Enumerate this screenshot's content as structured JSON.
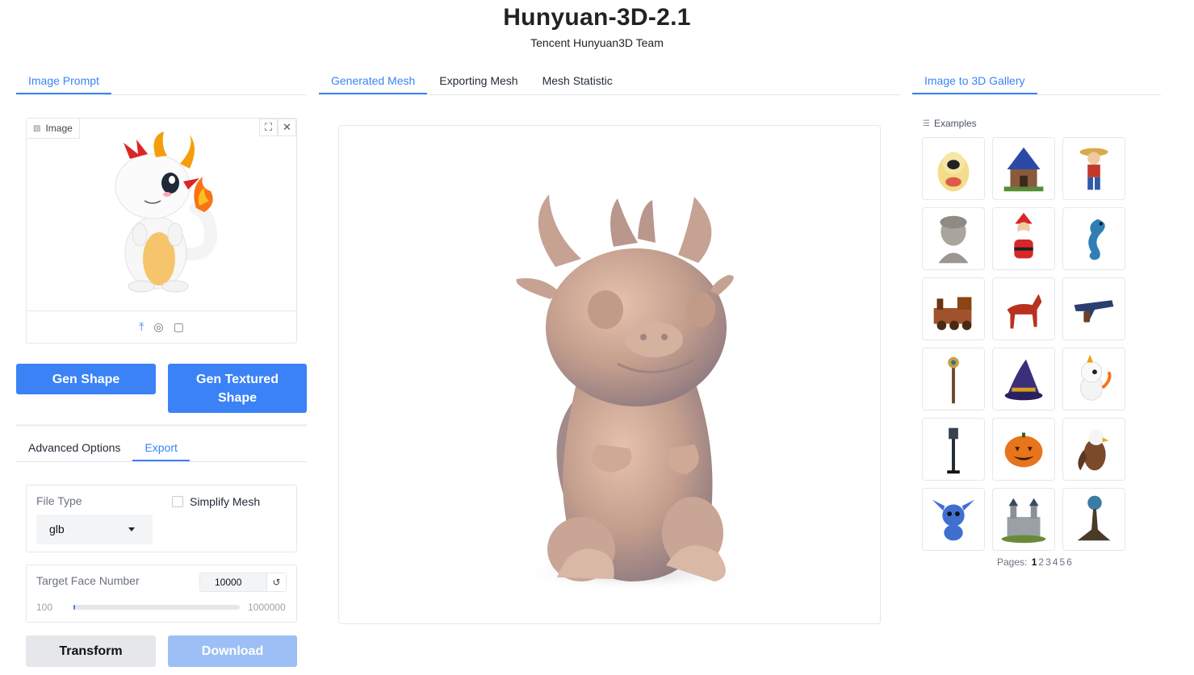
{
  "header": {
    "title": "Hunyuan-3D-2.1",
    "subtitle": "Tencent Hunyuan3D Team"
  },
  "left_tabs": [
    {
      "label": "Image Prompt",
      "active": true
    }
  ],
  "middle_tabs": [
    {
      "label": "Generated Mesh",
      "active": true
    },
    {
      "label": "Exporting Mesh",
      "active": false
    },
    {
      "label": "Mesh Statistic",
      "active": false
    }
  ],
  "right_tabs": [
    {
      "label": "Image to 3D Gallery",
      "active": true
    }
  ],
  "image_input": {
    "label": "Image"
  },
  "buttons": {
    "gen_shape": "Gen Shape",
    "gen_textured_l1": "Gen Textured",
    "gen_textured_l2": "Shape",
    "transform": "Transform",
    "download": "Download"
  },
  "options_tabs": [
    {
      "label": "Advanced Options",
      "active": false
    },
    {
      "label": "Export",
      "active": true
    }
  ],
  "export": {
    "file_type_label": "File Type",
    "file_type_value": "glb",
    "simplify_label": "Simplify Mesh",
    "simplify_checked": false,
    "target_face_label": "Target Face Number",
    "target_face_value": "10000",
    "slider_min": "100",
    "slider_max": "1000000",
    "slider_fraction": 0.01
  },
  "gallery": {
    "label": "Examples",
    "items": [
      "penguin-doll",
      "blue-house",
      "straw-hat-pirate",
      "marble-bust",
      "santa-claus",
      "seahorse",
      "steam-train",
      "red-horse",
      "revolver",
      "ornate-staff",
      "wizard-hat",
      "baby-dragon",
      "street-lamp",
      "jack-o-lantern",
      "eagle",
      "blue-alien-creature",
      "castle",
      "crystal-ball-tree"
    ],
    "pages_label": "Pages:",
    "pages": [
      "1",
      "2",
      "3",
      "4",
      "5",
      "6"
    ],
    "current_page": "1"
  },
  "colors": {
    "accent": "#3b82f6",
    "download_disabled": "#9dbff5",
    "grey_button": "#e5e7eb"
  }
}
